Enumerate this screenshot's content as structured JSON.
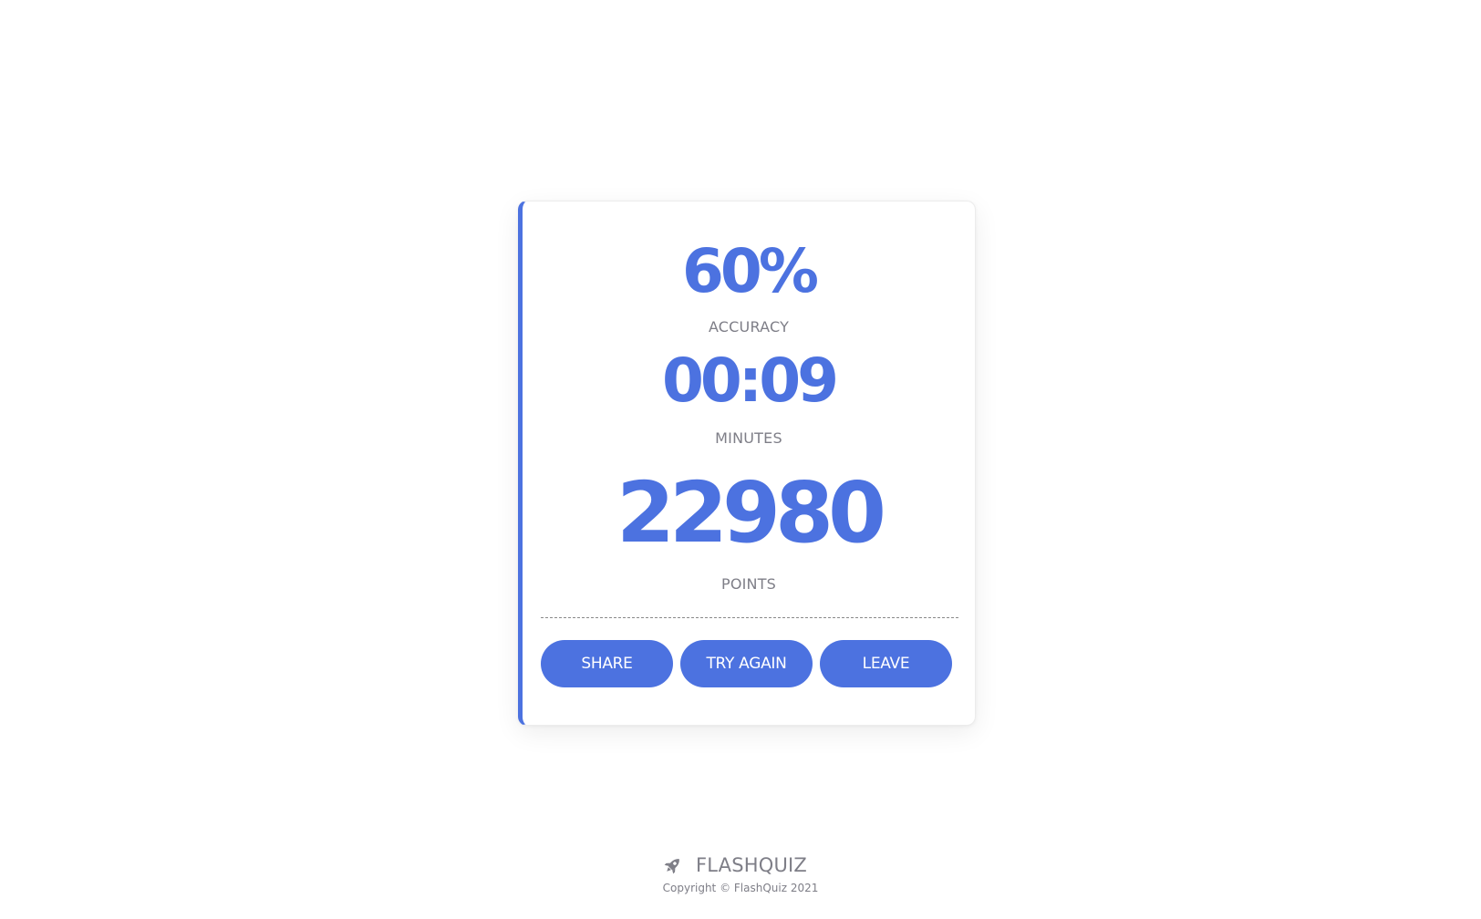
{
  "results": {
    "accuracy_value": "60%",
    "accuracy_label": "ACCURACY",
    "time_value": "00:09",
    "time_label": "MINUTES",
    "points_value": "22980",
    "points_label": "POINTS"
  },
  "actions": {
    "share_label": "SHARE",
    "try_again_label": "TRY AGAIN",
    "leave_label": "LEAVE"
  },
  "footer": {
    "brand_icon": "rocket-icon",
    "brand_name": "FLASHQUIZ",
    "copyright": "Copyright © FlashQuiz 2021"
  },
  "colors": {
    "accent": "#4c72e0",
    "muted_text": "#7e7e87",
    "background": "#ffffff"
  }
}
